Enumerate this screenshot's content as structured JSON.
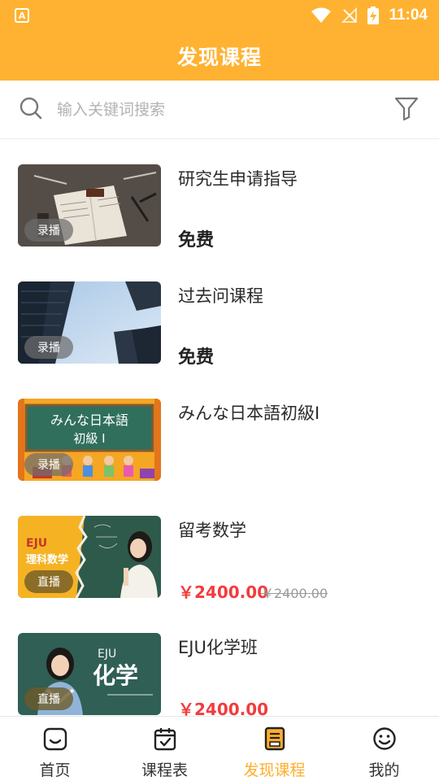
{
  "status_bar": {
    "app_badge": "A",
    "time": "11:04",
    "icons": [
      "app-notification-icon",
      "wifi-icon",
      "no-signal-icon",
      "battery-charging-icon"
    ]
  },
  "header": {
    "title": "发现课程"
  },
  "search": {
    "placeholder": "输入关键词搜索",
    "icons": [
      "search-icon",
      "filter-icon"
    ]
  },
  "courses": [
    {
      "title": "研究生申请指导",
      "badge": "录播",
      "price": "免费",
      "original_price": "",
      "thumb_text": ""
    },
    {
      "title": "过去问课程",
      "badge": "录播",
      "price": "免费",
      "original_price": "",
      "thumb_text": ""
    },
    {
      "title": "みんな日本語初級I",
      "badge": "录播",
      "price": "",
      "original_price": "",
      "thumb_text": "みんな日本語\n初級 I"
    },
    {
      "title": "留考数学",
      "badge": "直播",
      "price": "￥2400.00",
      "original_price": "￥2400.00",
      "thumb_text": "EJU 理科数学"
    },
    {
      "title": "EJU化学班",
      "badge": "直播",
      "price": "￥2400.00",
      "original_price": "",
      "thumb_text": "EJU 化学"
    }
  ],
  "bottom_nav": {
    "active": "发现课程",
    "items": [
      {
        "label": "首页",
        "icon": "home-icon"
      },
      {
        "label": "课程表",
        "icon": "calendar-check-icon"
      },
      {
        "label": "发现课程",
        "icon": "discover-book-icon"
      },
      {
        "label": "我的",
        "icon": "smiley-icon"
      }
    ]
  },
  "colors": {
    "brand": "#FFB231",
    "price": "#F23C3C",
    "nav_active": "#FFAE2B"
  }
}
